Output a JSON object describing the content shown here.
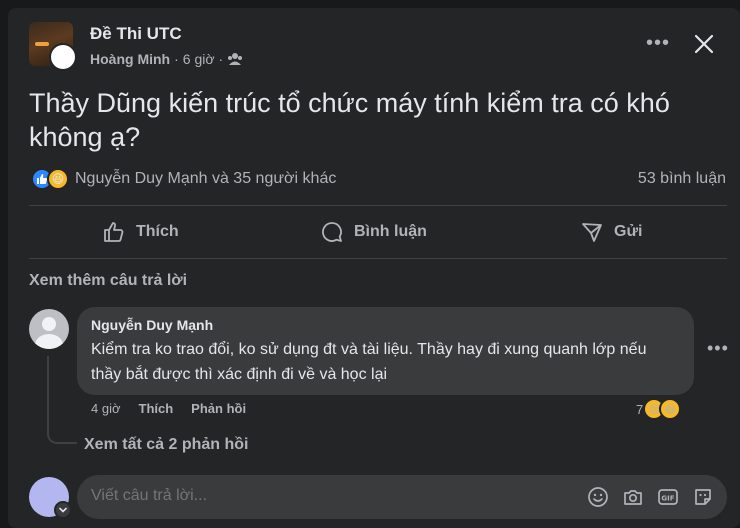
{
  "post": {
    "group_name": "Đề Thi UTC",
    "author": "Hoàng Minh",
    "separator": "·",
    "time": "6 giờ",
    "text": "Thầy Dũng kiến trúc tổ chức máy tính kiểm tra có khó không ạ?",
    "reaction_names": "Nguyễn Duy Mạnh và 35 người khác",
    "comment_count": "53 bình luận"
  },
  "actions": {
    "like": "Thích",
    "comment": "Bình luận",
    "send": "Gửi"
  },
  "comments": {
    "more_replies": "Xem thêm câu trả lời",
    "author": "Nguyễn Duy Mạnh",
    "text": "Kiểm tra ko trao đổi, ko sử dụng đt và tài liệu. Thầy hay đi xung quanh lớp nếu thầy bắt được thì xác định đi về và học lại",
    "time": "4 giờ",
    "like": "Thích",
    "reply": "Phản hồi",
    "reaction_count": "7",
    "view_all_replies": "Xem tất cả 2 phản hồi"
  },
  "reply_box": {
    "placeholder": "Viết câu trả lời..."
  },
  "icons": {
    "more": "more-horizontal-icon",
    "close": "close-icon",
    "audience": "group-audience-icon",
    "like": "like-thumb-icon",
    "comment": "comment-bubble-icon",
    "send": "send-icon",
    "emoji": "emoji-icon",
    "camera": "camera-icon",
    "gif": "gif-icon",
    "sticker": "sticker-icon"
  },
  "colors": {
    "background": "#18191a",
    "card": "#242526",
    "bubble": "#3a3b3c",
    "like_blue": "#2d88ff",
    "haha_yellow": "#f7b928"
  }
}
